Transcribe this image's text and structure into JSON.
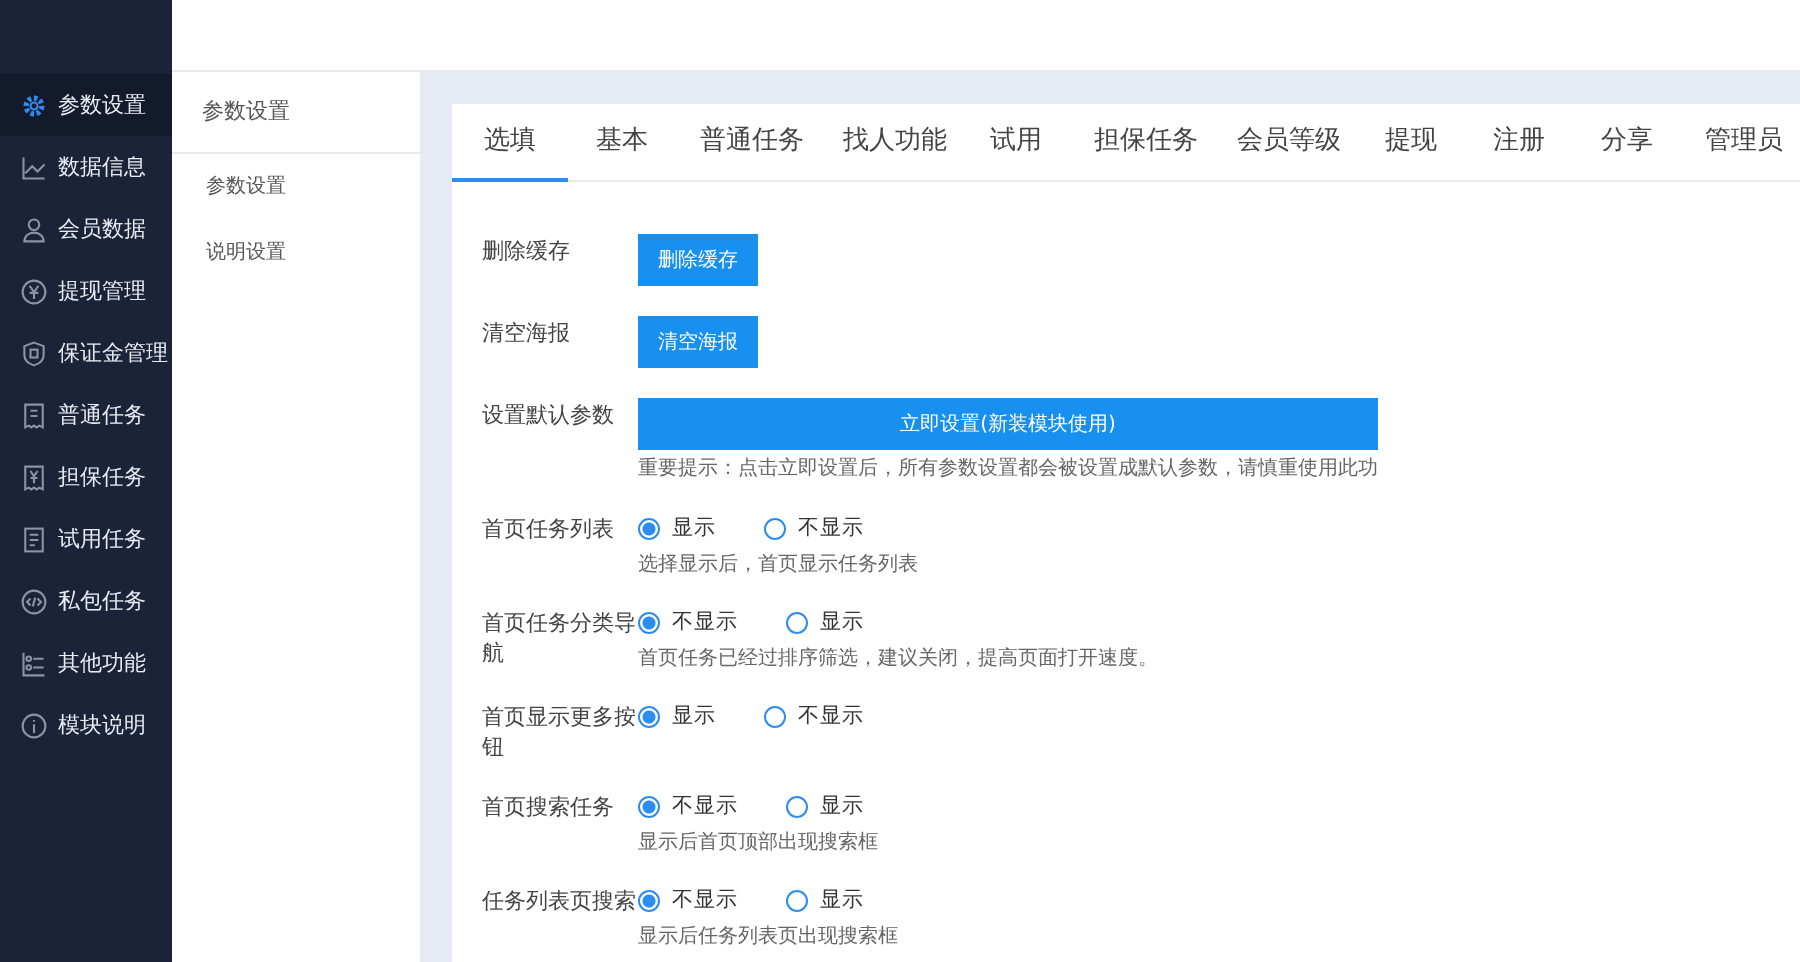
{
  "sidebar": {
    "items": [
      {
        "label": "参数设置",
        "selected": true
      },
      {
        "label": "数据信息",
        "selected": false
      },
      {
        "label": "会员数据",
        "selected": false
      },
      {
        "label": "提现管理",
        "selected": false
      },
      {
        "label": "保证金管理",
        "selected": false
      },
      {
        "label": "普通任务",
        "selected": false
      },
      {
        "label": "担保任务",
        "selected": false
      },
      {
        "label": "试用任务",
        "selected": false
      },
      {
        "label": "私包任务",
        "selected": false
      },
      {
        "label": "其他功能",
        "selected": false
      },
      {
        "label": "模块说明",
        "selected": false
      }
    ]
  },
  "submenu": {
    "title": "参数设置",
    "items": [
      {
        "label": "参数设置"
      },
      {
        "label": "说明设置"
      }
    ]
  },
  "tabs": [
    {
      "label": "选填",
      "selected": true
    },
    {
      "label": "基本",
      "selected": false
    },
    {
      "label": "普通任务",
      "selected": false
    },
    {
      "label": "找人功能",
      "selected": false
    },
    {
      "label": "试用",
      "selected": false
    },
    {
      "label": "担保任务",
      "selected": false
    },
    {
      "label": "会员等级",
      "selected": false
    },
    {
      "label": "提现",
      "selected": false
    },
    {
      "label": "注册",
      "selected": false
    },
    {
      "label": "分享",
      "selected": false
    },
    {
      "label": "管理员",
      "selected": false
    }
  ],
  "settings": [
    {
      "kind": "button",
      "label": "删除缓存",
      "button": "删除缓存"
    },
    {
      "kind": "button",
      "label": "清空海报",
      "button": "清空海报"
    },
    {
      "kind": "button",
      "label": "设置默认参数",
      "button": "立即设置(新装模块使用)",
      "note": "重要提示：点击立即设置后，所有参数设置都会被设置成默认参数，请慎重使用此功"
    },
    {
      "kind": "radio",
      "label": "首页任务列表",
      "options": [
        {
          "label": "显示",
          "selected": true
        },
        {
          "label": "不显示",
          "selected": false
        }
      ],
      "note": "选择显示后，首页显示任务列表"
    },
    {
      "kind": "radio",
      "label": "首页任务分类导航",
      "options": [
        {
          "label": "不显示",
          "selected": true
        },
        {
          "label": "显示",
          "selected": false
        }
      ],
      "note": "首页任务已经过排序筛选，建议关闭，提高页面打开速度。"
    },
    {
      "kind": "radio",
      "label": "首页显示更多按钮",
      "options": [
        {
          "label": "显示",
          "selected": true
        },
        {
          "label": "不显示",
          "selected": false
        }
      ]
    },
    {
      "kind": "radio",
      "label": "首页搜索任务",
      "options": [
        {
          "label": "不显示",
          "selected": true
        },
        {
          "label": "显示",
          "selected": false
        }
      ],
      "note": "显示后首页顶部出现搜索框"
    },
    {
      "kind": "radio",
      "label": "任务列表页搜索",
      "options": [
        {
          "label": "不显示",
          "selected": true
        },
        {
          "label": "显示",
          "selected": false
        }
      ],
      "note": "显示后任务列表页出现搜索框"
    }
  ]
}
